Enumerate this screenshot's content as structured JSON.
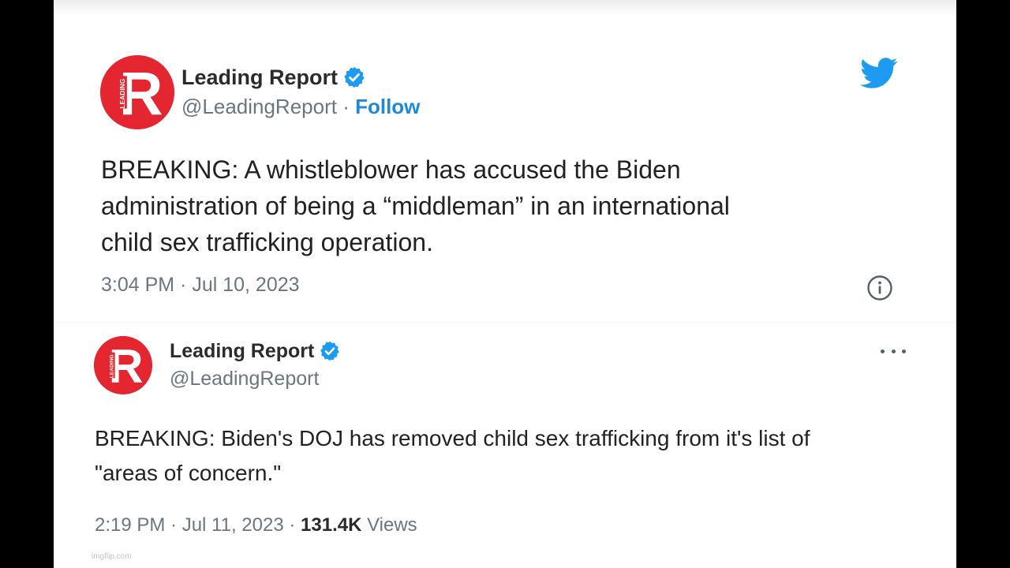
{
  "tweets": [
    {
      "author": {
        "name": "Leading Report",
        "handle": "@LeadingReport",
        "avatar_letter": "R",
        "avatar_small_text": "LEADING"
      },
      "separator": " · ",
      "follow_label": "Follow",
      "text": "BREAKING: A whistleblower has accused the Biden\nadministration of being a “middleman” in an international\nchild sex trafficking operation.",
      "time": "3:04 PM · Jul 10, 2023"
    },
    {
      "author": {
        "name": "Leading Report",
        "handle": "@LeadingReport",
        "avatar_letter": "R",
        "avatar_small_text": "LEADING"
      },
      "text": "BREAKING: Biden's DOJ has removed child sex trafficking from it's list of\n\"areas of concern.\"",
      "time": "2:19 PM · Jul 11, 2023 · ",
      "views_count": "131.4K",
      "views_label": " Views"
    }
  ],
  "watermark": "imgflip.com",
  "colors": {
    "avatar_red": "#e3262f",
    "verified_blue": "#1d9bf0",
    "twitter_blue": "#1d9bf0",
    "link_blue": "#1d8ad8",
    "text_dark": "#222222",
    "text_gray": "#6b7680"
  },
  "icons": {
    "verified": "verified-badge-icon",
    "bird": "twitter-bird-icon",
    "info": "info-icon",
    "more": "more-options-icon"
  }
}
